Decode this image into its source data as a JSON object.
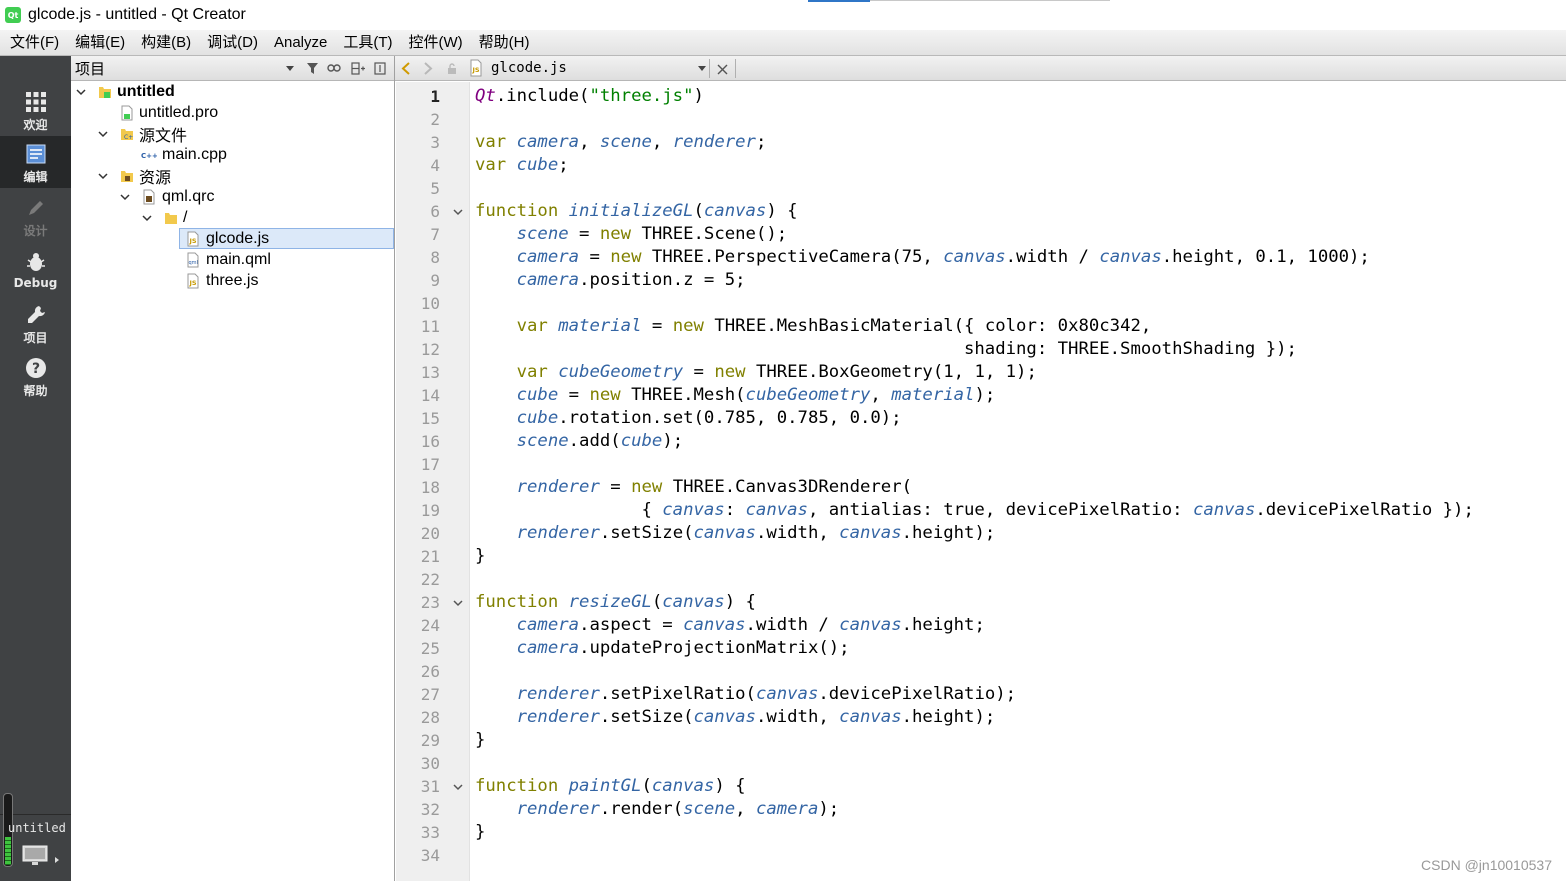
{
  "window": {
    "title": "glcode.js - untitled - Qt Creator",
    "logo_text": "Qt"
  },
  "menu": [
    "文件(F)",
    "编辑(E)",
    "构建(B)",
    "调试(D)",
    "Analyze",
    "工具(T)",
    "控件(W)",
    "帮助(H)"
  ],
  "modes": [
    {
      "label": "欢迎",
      "icon": "grid-icon",
      "state": "normal"
    },
    {
      "label": "编辑",
      "icon": "edit-document-icon",
      "state": "active"
    },
    {
      "label": "设计",
      "icon": "pencil-icon",
      "state": "disabled"
    },
    {
      "label": "Debug",
      "icon": "bug-icon",
      "state": "normal"
    },
    {
      "label": "项目",
      "icon": "wrench-icon",
      "state": "normal"
    },
    {
      "label": "帮助",
      "icon": "help-icon",
      "state": "normal"
    }
  ],
  "kit": {
    "project_name": "untitled"
  },
  "project_panel": {
    "title": "项目",
    "tree": [
      {
        "label": "untitled",
        "icon": "project-folder-icon",
        "bold": true,
        "expanded": true
      },
      {
        "label": "untitled.pro",
        "icon": "pro-file-icon"
      },
      {
        "label": "源文件",
        "icon": "sources-folder-icon",
        "expanded": true
      },
      {
        "label": "main.cpp",
        "icon": "cpp-file-icon"
      },
      {
        "label": "资源",
        "icon": "resources-folder-icon",
        "expanded": true
      },
      {
        "label": "qml.qrc",
        "icon": "qrc-file-icon",
        "expanded": true
      },
      {
        "label": "/",
        "icon": "folder-icon",
        "expanded": true
      },
      {
        "label": "glcode.js",
        "icon": "js-file-icon",
        "selected": true
      },
      {
        "label": "main.qml",
        "icon": "qml-file-icon"
      },
      {
        "label": "three.js",
        "icon": "js-file-icon"
      }
    ]
  },
  "editor": {
    "document_name": "glcode.js",
    "current_line": 1,
    "fold_lines": [
      6,
      23,
      31
    ],
    "lines": [
      "Qt.include(\"three.js\")",
      "",
      "var camera, scene, renderer;",
      "var cube;",
      "",
      "function initializeGL(canvas) {",
      "    scene = new THREE.Scene();",
      "    camera = new THREE.PerspectiveCamera(75, canvas.width / canvas.height, 0.1, 1000);",
      "    camera.position.z = 5;",
      "",
      "    var material = new THREE.MeshBasicMaterial({ color: 0x80c342,",
      "                                               shading: THREE.SmoothShading });",
      "    var cubeGeometry = new THREE.BoxGeometry(1, 1, 1);",
      "    cube = new THREE.Mesh(cubeGeometry, material);",
      "    cube.rotation.set(0.785, 0.785, 0.0);",
      "    scene.add(cube);",
      "",
      "    renderer = new THREE.Canvas3DRenderer(",
      "                { canvas: canvas, antialias: true, devicePixelRatio: canvas.devicePixelRatio });",
      "    renderer.setSize(canvas.width, canvas.height);",
      "}",
      "",
      "function resizeGL(canvas) {",
      "    camera.aspect = canvas.width / canvas.height;",
      "    camera.updateProjectionMatrix();",
      "",
      "    renderer.setPixelRatio(canvas.devicePixelRatio);",
      "    renderer.setSize(canvas.width, canvas.height);",
      "}",
      "",
      "function paintGL(canvas) {",
      "    renderer.render(scene, camera);",
      "}",
      ""
    ]
  },
  "watermark": "CSDN @jn10010537",
  "colors": {
    "keyword": "#808000",
    "variable": "#3465a4",
    "string": "#008000",
    "qt": "#800080",
    "mode_bar": "#404244",
    "selection": "#dce9f9"
  }
}
